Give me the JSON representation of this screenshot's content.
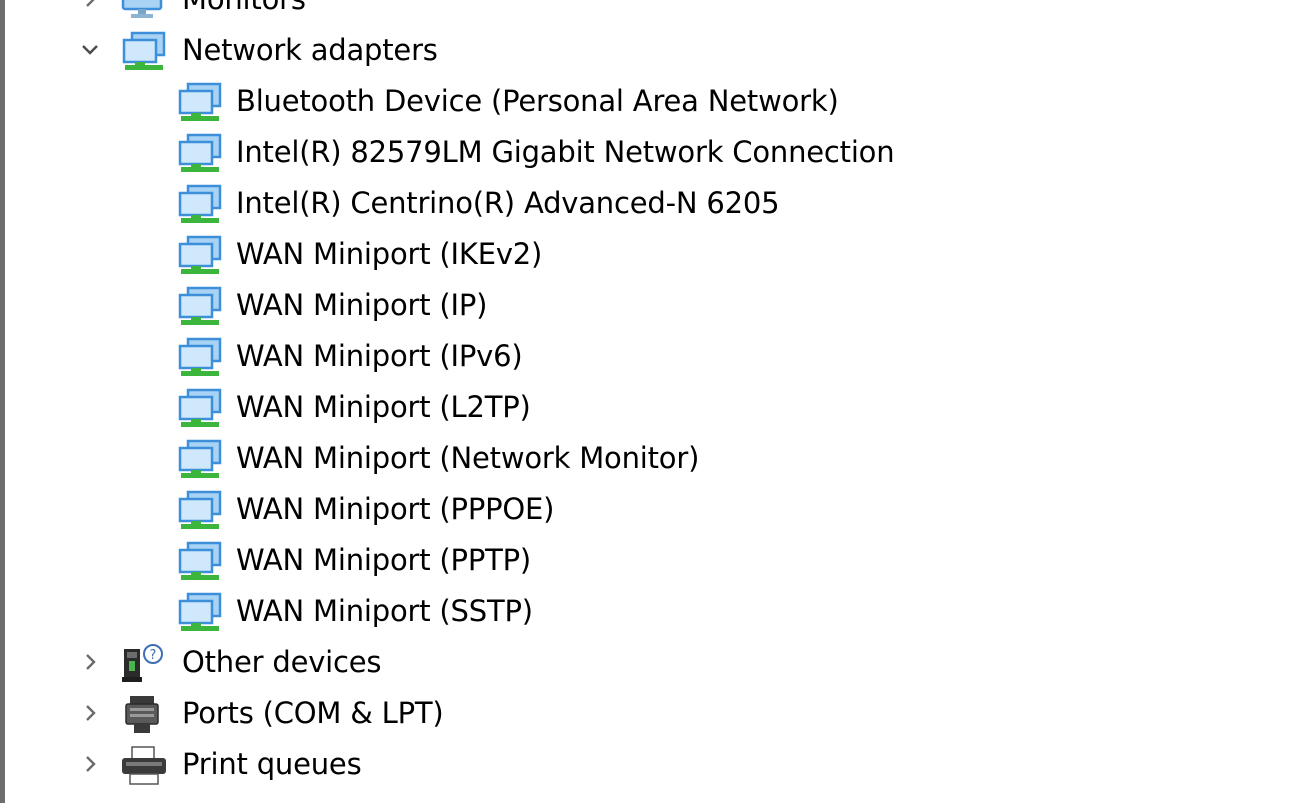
{
  "tree": {
    "categories_before": [
      {
        "label": "Monitors",
        "icon": "monitor-icon",
        "expanded": false
      }
    ],
    "network_adapters": {
      "label": "Network adapters",
      "icon": "network-adapter-icon",
      "expanded": true,
      "children": [
        {
          "label": "Bluetooth Device (Personal Area Network)",
          "icon": "network-adapter-icon"
        },
        {
          "label": "Intel(R) 82579LM Gigabit Network Connection",
          "icon": "network-adapter-icon"
        },
        {
          "label": "Intel(R) Centrino(R) Advanced-N 6205",
          "icon": "network-adapter-icon"
        },
        {
          "label": "WAN Miniport (IKEv2)",
          "icon": "network-adapter-icon"
        },
        {
          "label": "WAN Miniport (IP)",
          "icon": "network-adapter-icon"
        },
        {
          "label": "WAN Miniport (IPv6)",
          "icon": "network-adapter-icon"
        },
        {
          "label": "WAN Miniport (L2TP)",
          "icon": "network-adapter-icon"
        },
        {
          "label": "WAN Miniport (Network Monitor)",
          "icon": "network-adapter-icon"
        },
        {
          "label": "WAN Miniport (PPPOE)",
          "icon": "network-adapter-icon"
        },
        {
          "label": "WAN Miniport (PPTP)",
          "icon": "network-adapter-icon"
        },
        {
          "label": "WAN Miniport (SSTP)",
          "icon": "network-adapter-icon"
        }
      ]
    },
    "categories_after": [
      {
        "label": "Other devices",
        "icon": "unknown-device-icon",
        "expanded": false
      },
      {
        "label": "Ports (COM & LPT)",
        "icon": "port-icon",
        "expanded": false
      },
      {
        "label": "Print queues",
        "icon": "printer-icon",
        "expanded": false
      }
    ]
  },
  "colors": {
    "monitor_blue": "#3c8fd8",
    "monitor_light": "#a9d3f5",
    "network_green": "#3bb53b",
    "border_gray": "#6d6d6d"
  }
}
